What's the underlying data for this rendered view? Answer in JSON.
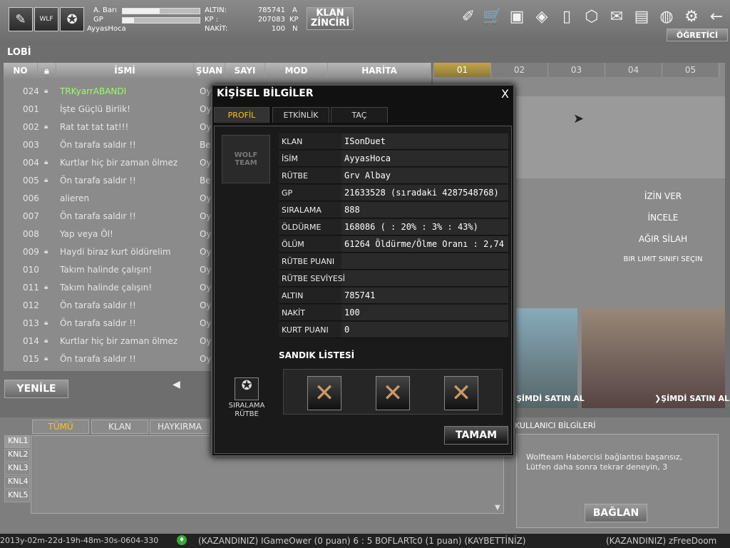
{
  "top": {
    "name_label": "A. Barı",
    "gp_label": "GP",
    "username": "AyyasHoca",
    "altin_label": "ALTIN:",
    "kp_label": "KP :",
    "nakit_label": "NAKİT:",
    "altin_value": "785741",
    "kp_value": "207083",
    "nakit_value": "100",
    "altin_unit": "A",
    "kp_unit": "KP",
    "nakit_unit": "N",
    "hp_progress": 0.48,
    "gp_progress": 0.15,
    "klan_button": [
      "KLAN",
      "ZİNCİRİ"
    ],
    "ogretici_button": "ÖĞRETİCİ"
  },
  "lobby": {
    "title": "LOBİ",
    "columns": [
      "NO",
      "İSMİ",
      "ŞUAN",
      "SAYI",
      "MOD",
      "HARİTA"
    ],
    "rows": [
      {
        "no": "024",
        "lock": true,
        "name": "TRKyarrABANDI",
        "status": "Oy",
        "highlight": true
      },
      {
        "no": "001",
        "lock": false,
        "name": "İşte Güçlü Birlik!",
        "status": "Oy"
      },
      {
        "no": "002",
        "lock": true,
        "name": "Rat tat tat tat!!!",
        "status": "Oy"
      },
      {
        "no": "003",
        "lock": false,
        "name": "Ön tarafa saldır !!",
        "status": "Be"
      },
      {
        "no": "004",
        "lock": true,
        "name": "Kurtlar hiç bir zaman ölmez",
        "status": "Oy"
      },
      {
        "no": "005",
        "lock": true,
        "name": "Ön tarafa saldır !!",
        "status": "Be"
      },
      {
        "no": "006",
        "lock": false,
        "name": "alieren",
        "status": "Oy"
      },
      {
        "no": "007",
        "lock": false,
        "name": "Ön tarafa saldır !!",
        "status": "Oy"
      },
      {
        "no": "008",
        "lock": false,
        "name": "Yap veya Öl!",
        "status": "Oy"
      },
      {
        "no": "009",
        "lock": true,
        "name": "Haydi biraz kurt öldürelim",
        "status": "Oy"
      },
      {
        "no": "010",
        "lock": false,
        "name": "Takım halinde çalışın!",
        "status": "Oy"
      },
      {
        "no": "011",
        "lock": true,
        "name": "Takım halinde çalışın!",
        "status": "Oy"
      },
      {
        "no": "012",
        "lock": false,
        "name": "Ön tarafa saldır !!",
        "status": "Oy"
      },
      {
        "no": "013",
        "lock": true,
        "name": "Ön tarafa saldır !!",
        "status": "Oy"
      },
      {
        "no": "014",
        "lock": true,
        "name": "Kurtlar hiç bir zaman ölmez",
        "status": "Oy"
      },
      {
        "no": "015",
        "lock": true,
        "name": "Ön tarafa saldır !!",
        "status": "Oy"
      }
    ],
    "refresh": "YENİLE"
  },
  "right": {
    "tabs": [
      "01",
      "02",
      "03",
      "04",
      "05"
    ],
    "izin_ver": "İZİN VER",
    "incele": "İNCELE",
    "agir_silah": "AĞIR SİLAH",
    "limit": "BIR LIMIT SINIFI SEÇIN",
    "buy1": "ŞİMDİ SATIN AL",
    "buy2": "❯ŞİMDİ SATIN AL",
    "user_info_title": "KULLANICI BİLGİLERİ",
    "msg1": "Wolfteam Habercisi bağlantısı başarısız,",
    "msg2": "Lütfen daha sonra tekrar deneyin, 3",
    "baglan": "BAĞLAN"
  },
  "modal": {
    "title": "KİŞİSEL BİLGİLER",
    "close": "X",
    "tabs": [
      "PROFİL",
      "ETKİNLİK",
      "TAÇ"
    ],
    "rank_label": [
      "SIRALAMA",
      "RÜTBE"
    ],
    "logo_text": "WOLF TEAM",
    "fields": [
      {
        "k": "KLAN",
        "v": "ISonDuet"
      },
      {
        "k": "İSİM",
        "v": "AyyasHoca"
      },
      {
        "k": "RÜTBE",
        "v": "Grv Albay"
      },
      {
        "k": "GP",
        "v": "21633528 (sıradaki 4287548768)"
      },
      {
        "k": "SIRALAMA",
        "v": "888"
      },
      {
        "k": "ÖLDÜRME",
        "v": "168086  ( : 20%  : 3%  : 43%)"
      },
      {
        "k": "ÖLÜM",
        "v": "61264  Öldürme/Ölme Oranı : 2,74"
      },
      {
        "k": "RÜTBE PUANI",
        "v": ""
      },
      {
        "k": "RÜTBE SEVİYESİ",
        "v": ""
      },
      {
        "k": "ALTIN",
        "v": "785741"
      },
      {
        "k": "NAKİT",
        "v": "100"
      },
      {
        "k": "KURT PUANI",
        "v": "0"
      }
    ],
    "chest_title": "SANDIK LİSTESİ",
    "ok": "TAMAM"
  },
  "bottom": {
    "tabs": [
      "TÜMÜ",
      "KLAN",
      "HAYKIRMA"
    ],
    "channels": [
      "KNL1",
      "KNL2",
      "KNL3",
      "KNL4",
      "KNL5"
    ]
  },
  "status": {
    "timestamp": "2013y-02m-22d-19h-48m-30s-0604-330",
    "ticker": "(KAZANDINIZ) IGameOwer (0 puan) 6 : 5 BOFLARTc0 (1 puan) (KAYBETTİNİZ)",
    "ticker2": "(KAZANDINIZ) zFreeDoom"
  }
}
